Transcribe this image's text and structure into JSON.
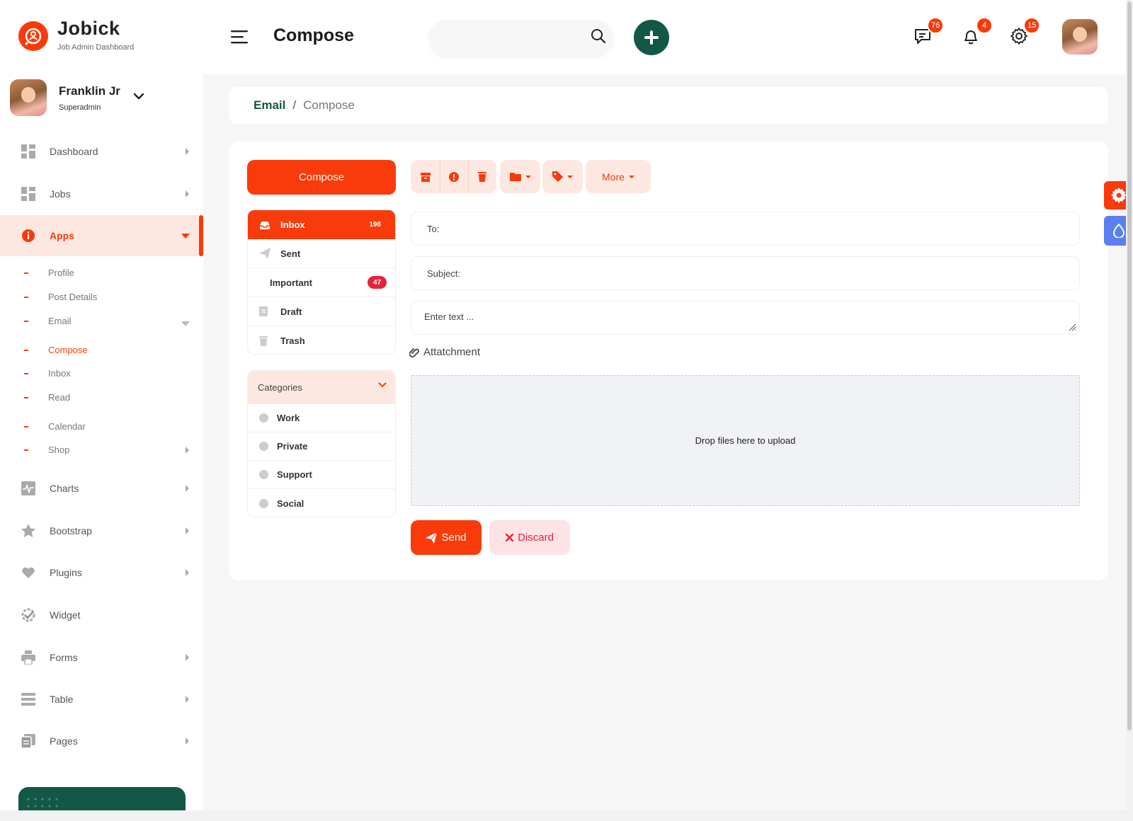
{
  "brand": {
    "name": "Jobick",
    "subtitle": "Job Admin Dashboard"
  },
  "header": {
    "title": "Compose",
    "search": {
      "placeholder": "",
      "value": ""
    },
    "badges": {
      "messages": "76",
      "notifications": "4",
      "settings": "15"
    }
  },
  "user": {
    "name": "Franklin Jr",
    "role": "Superadmin"
  },
  "sidebar": {
    "items": [
      {
        "label": "Dashboard",
        "icon": "grid-icon"
      },
      {
        "label": "Jobs",
        "icon": "grid-icon"
      },
      {
        "label": "Apps",
        "icon": "info-icon"
      },
      {
        "label": "Charts",
        "icon": "chart-icon"
      },
      {
        "label": "Bootstrap",
        "icon": "star-icon"
      },
      {
        "label": "Plugins",
        "icon": "heart-icon"
      },
      {
        "label": "Widget",
        "icon": "widget-icon"
      },
      {
        "label": "Forms",
        "icon": "printer-icon"
      },
      {
        "label": "Table",
        "icon": "table-icon"
      },
      {
        "label": "Pages",
        "icon": "pages-icon"
      }
    ],
    "apps_sub": [
      "Profile",
      "Post Details",
      "Email",
      "Compose",
      "Inbox",
      "Read",
      "Calendar",
      "Shop"
    ]
  },
  "breadcrumb": {
    "parent": "Email",
    "separator": "/",
    "current": "Compose"
  },
  "email": {
    "compose_label": "Compose",
    "folders": [
      {
        "label": "Inbox",
        "count": "198"
      },
      {
        "label": "Sent"
      },
      {
        "label": "Important",
        "count": "47"
      },
      {
        "label": "Draft"
      },
      {
        "label": "Trash"
      }
    ],
    "categories_title": "Categories",
    "categories": [
      "Work",
      "Private",
      "Support",
      "Social"
    ],
    "toolbar": {
      "more_label": "More"
    },
    "to_placeholder": "To:",
    "subject_placeholder": "Subject:",
    "body_placeholder": "Enter text ...",
    "attachment_label": "Attatchment",
    "dropzone_text": "Drop files here to upload",
    "send_label": "Send",
    "discard_label": "Discard"
  },
  "colors": {
    "accent": "#f93a0b",
    "primary_dark": "#135846",
    "accent_light": "#fde8e1",
    "danger": "#e8213b",
    "blue": "#5b7ff0"
  }
}
